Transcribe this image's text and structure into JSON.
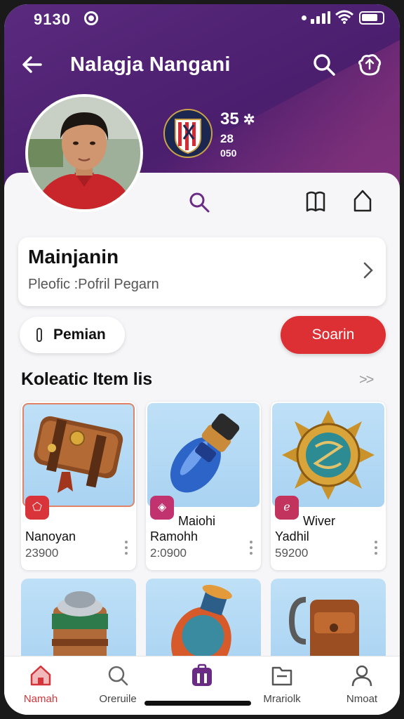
{
  "status_bar": {
    "time": "9130"
  },
  "top_bar": {
    "title": "Nalagja Nangani"
  },
  "profile_header": {
    "stat_primary": "35",
    "stat_secondary": "28",
    "stat_tertiary": "050"
  },
  "profile_card": {
    "name": "Mainjanin",
    "subtitle": "Pleofic :Pofril Pegarn"
  },
  "actions": {
    "pill_label": "Pemian",
    "primary_label": "Soarin"
  },
  "section": {
    "title": "Koleatic Item lis",
    "more": ">>"
  },
  "items": [
    {
      "line1": "Nanoyan",
      "line2": "23900",
      "tag_color": "#d8343a",
      "tag_icon": "pentagon-icon"
    },
    {
      "line1": "Maiohi",
      "line1b": "Ramohh",
      "line2": "2:0900",
      "tag_color": "#c0336f",
      "tag_icon": "shield-icon"
    },
    {
      "line1": "Wiver",
      "line1b": "Yadhil",
      "line2": "59200",
      "tag_color": "#c2335d",
      "tag_icon": "swirl-icon"
    }
  ],
  "bottom_nav": [
    {
      "label": "Namah",
      "icon": "home-icon",
      "active": true
    },
    {
      "label": "Oreruile",
      "icon": "search-icon"
    },
    {
      "label": "",
      "icon": "bag-icon"
    },
    {
      "label": "Mrariolk",
      "icon": "folder-icon"
    },
    {
      "label": "Nmoat",
      "icon": "user-icon"
    }
  ],
  "colors": {
    "header": "#4b1e6e",
    "accent_red": "#dc3034",
    "accent_purple": "#6a2b85"
  }
}
